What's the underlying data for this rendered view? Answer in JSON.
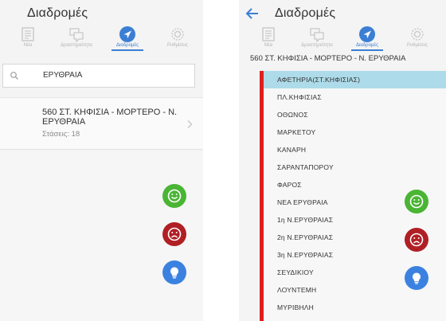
{
  "app": {
    "title": "Διαδρομές"
  },
  "tabs": [
    {
      "label": "Νέα",
      "icon": "news-icon"
    },
    {
      "label": "Δραστηριότητα",
      "icon": "chat-icon"
    },
    {
      "label": "Διαδρομές",
      "icon": "navigation-icon",
      "active": true
    },
    {
      "label": "Ρυθμίσεις",
      "icon": "gear-icon"
    }
  ],
  "search": {
    "value": "ΕΡΥΘΡΑΙΑ"
  },
  "results": [
    {
      "title": "560 ΣΤ. ΚΗΦΙΣΙΑ - ΜΟΡΤΕΡΟ - Ν. ΕΡΥΘΡΑΙΑ",
      "stops": "Στάσεις: 18"
    }
  ],
  "detail": {
    "route_title": "560 ΣΤ. ΚΗΦΙΣΙΑ - ΜΟΡΤΕΡΟ - Ν. ΕΡΥΘΡΑΙΑ",
    "stops": [
      "ΑΦΕΤΗΡΙΑ(ΣΤ.ΚΗΦΙΣΙΑΣ)",
      "ΠΛ.ΚΗΦΙΣΙΑΣ",
      "ΟΘΩΝΟΣ",
      "ΜΑΡΚΕΤΟΥ",
      "ΚΑΝΑΡΗ",
      "ΣΑΡΑΝΤΑΠΟΡΟΥ",
      "ΦΑΡΟΣ",
      "ΝΕΑ ΕΡΥΘΡΑΙΑ",
      "1η Ν.ΕΡΥΘΡΑΙΑΣ",
      "2η Ν.ΕΡΥΘΡΑΙΑΣ",
      "3η Ν.ΕΡΥΘΡΑΙΑΣ",
      "ΣΕΥΔΙΚΙΟΥ",
      "ΛΟΥΝΤΕΜΗ",
      "ΜΥΡΙΒΗΛΗ"
    ]
  },
  "fabs": [
    {
      "name": "happy-feedback",
      "icon": "happy-face-icon",
      "color": "#4ab534"
    },
    {
      "name": "sad-feedback",
      "icon": "sad-face-icon",
      "color": "#b01f24"
    },
    {
      "name": "idea-feedback",
      "icon": "lightbulb-icon",
      "color": "#3b82e0"
    }
  ],
  "colors": {
    "accent": "#3b7fd4",
    "route_line": "#e01e1e",
    "selected_stop": "#aedbe9"
  }
}
